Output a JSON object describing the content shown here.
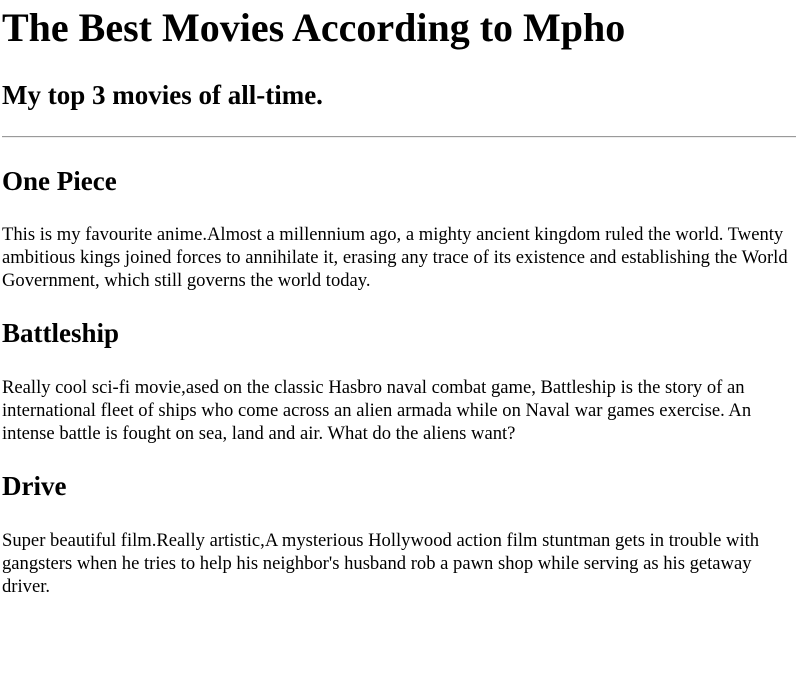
{
  "page": {
    "title": "The Best Movies According to Mpho",
    "subtitle": "My top 3 movies of all-time."
  },
  "movies": [
    {
      "name": "One Piece",
      "description": "This is my favourite anime.Almost a millennium ago, a mighty ancient kingdom ruled the world. Twenty ambitious kings joined forces to annihilate it, erasing any trace of its existence and establishing the World Government, which still governs the world today."
    },
    {
      "name": "Battleship",
      "description": "Really cool sci-fi movie,ased on the classic Hasbro naval combat game, Battleship is the story of an international fleet of ships who come across an alien armada while on Naval war games exercise. An intense battle is fought on sea, land and air. What do the aliens want?"
    },
    {
      "name": "Drive",
      "description": "Super beautiful film.Really artistic,A mysterious Hollywood action film stuntman gets in trouble with gangsters when he tries to help his neighbor's husband rob a pawn shop while serving as his getaway driver."
    }
  ]
}
